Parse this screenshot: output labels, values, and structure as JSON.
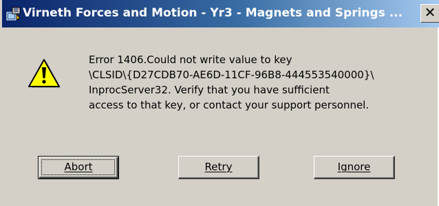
{
  "window": {
    "title": "Virneth Forces and Motion - Yr3 - Magnets and Springs ...",
    "close_glyph": "✕",
    "title_bar_colors": [
      "#0a246a",
      "#a6caf0"
    ]
  },
  "dialog": {
    "icon": "warning-icon",
    "message_lines": [
      "Error 1406.Could not write value  to key",
      "\\CLSID\\{D27CDB70-AE6D-11CF-96B8-444553540000}\\",
      "InprocServer32.   Verify that you have sufficient",
      "access to that key, or contact your support personnel."
    ]
  },
  "buttons": {
    "abort": "Abort",
    "retry": "Retry",
    "ignore": "Ignore"
  },
  "colors": {
    "dialog_background": "#d4d0c8",
    "warning_yellow": "#ffff00"
  }
}
